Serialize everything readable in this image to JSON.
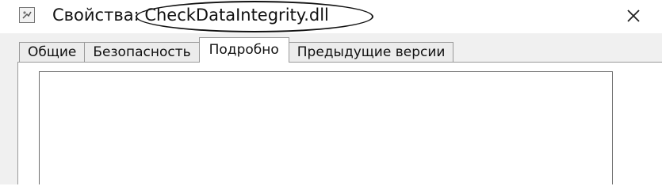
{
  "window": {
    "title_prefix": "Свойства:",
    "file_name": "CheckDataIntegrity.dll",
    "close_glyph": "✕"
  },
  "tabs": [
    {
      "label": "Общие",
      "active": false
    },
    {
      "label": "Безопасность",
      "active": false
    },
    {
      "label": "Подробно",
      "active": true
    },
    {
      "label": "Предыдущие версии",
      "active": false
    }
  ],
  "icons": {
    "app": "dll-file-icon",
    "close": "close-icon"
  }
}
